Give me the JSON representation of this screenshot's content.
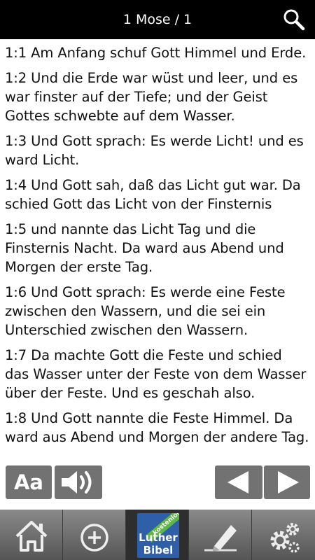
{
  "header": {
    "title": "1 Mose / 1",
    "search_icon": "search-icon"
  },
  "verses": [
    "1:1 Am Anfang schuf Gott Himmel und Erde.",
    "1:2 Und die Erde war wüst und leer, und es war finster auf der Tiefe; und der Geist Gottes schwebte auf dem Wasser.",
    "1:3 Und Gott sprach: Es werde Licht! und es ward Licht.",
    "1:4 Und Gott sah, daß das Licht gut war. Da schied Gott das Licht von der Finsternis",
    "1:5 und nannte das Licht Tag und die Finsternis Nacht. Da ward aus Abend und Morgen der erste Tag.",
    "1:6 Und Gott sprach: Es werde eine Feste zwischen den Wassern, und die sei ein Unterschied zwischen den Wassern.",
    "1:7 Da machte Gott die Feste und schied das Wasser unter der Feste von dem Wasser über der Feste. Und es geschah also.",
    "1:8 Und Gott nannte die Feste Himmel. Da ward aus Abend und Morgen der andere Tag."
  ],
  "controls": {
    "font_label": "Aa",
    "audio_icon": "speaker-icon",
    "prev_icon": "prev-arrow-icon",
    "next_icon": "next-arrow-icon"
  },
  "bottom_nav": {
    "home_icon": "home-icon",
    "add_icon": "add-circle-icon",
    "bible_ribbon": "kostenlos",
    "bible_line1": "Luther",
    "bible_line2": "Bibel",
    "notes_icon": "pen-icon",
    "settings_icon": "gear-icon"
  },
  "colors": {
    "header_bg": "#000000",
    "text": "#111111",
    "nav_bg": "#6e6e6e",
    "bible_blue": "#2e5fa8",
    "ribbon_green": "#5cb840"
  }
}
